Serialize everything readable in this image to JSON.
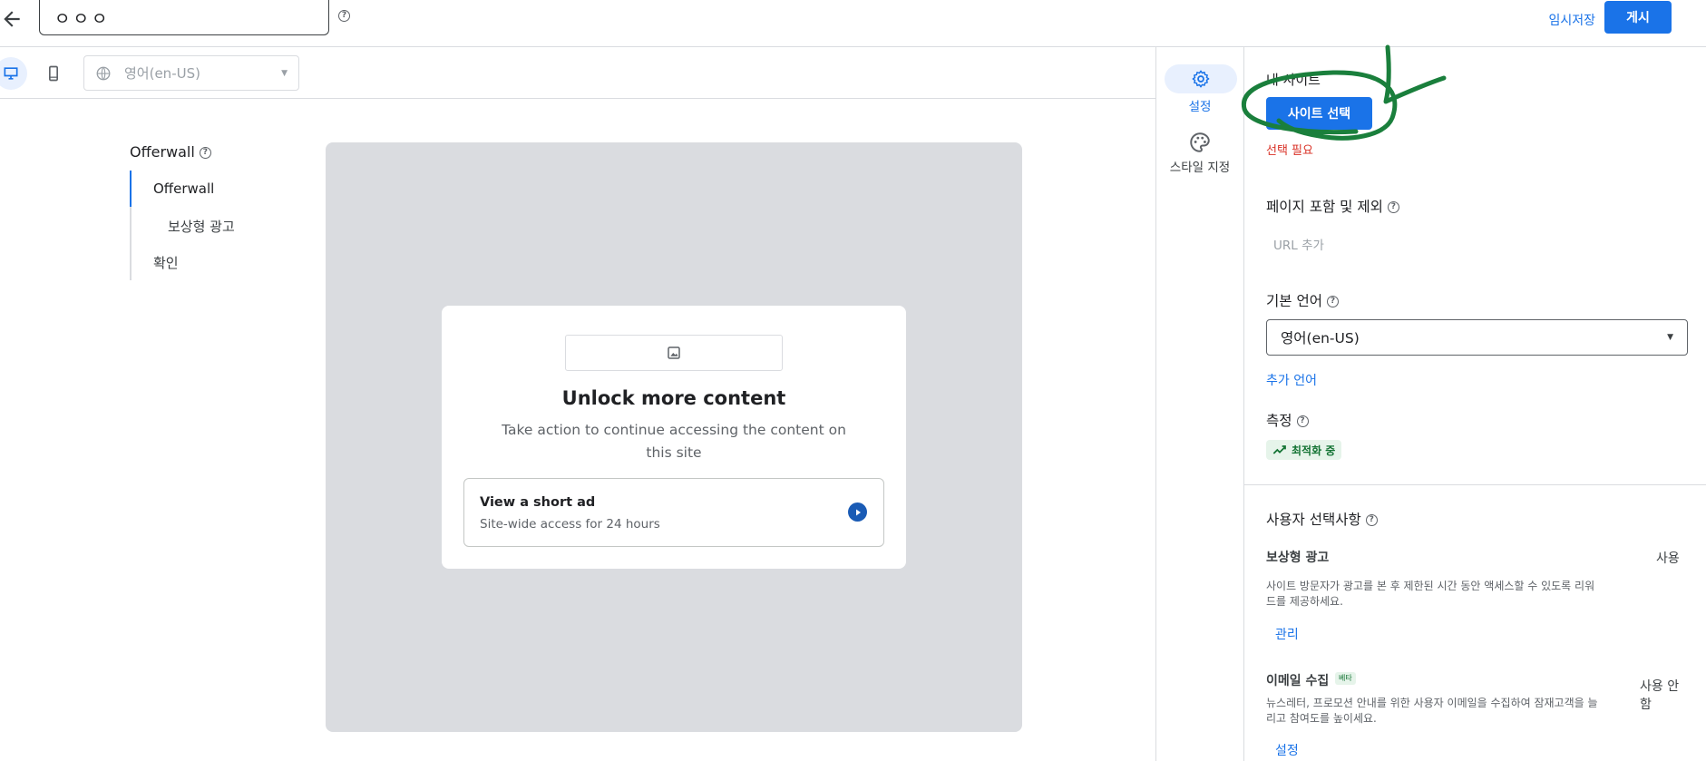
{
  "header": {
    "name_value": "ㅇㅇㅇ",
    "draft_label": "임시저장",
    "publish_label": "게시"
  },
  "toolbar": {
    "preview_language": "영어(en-US)"
  },
  "nav": {
    "title": "Offerwall",
    "items": [
      {
        "label": "Offerwall"
      },
      {
        "label": "보상형 광고"
      },
      {
        "label": "확인"
      }
    ]
  },
  "preview": {
    "title": "Unlock more content",
    "description": "Take action to continue accessing the content on this site",
    "option_title": "View a short ad",
    "option_subtitle": "Site-wide access for 24 hours"
  },
  "rail": {
    "settings_label": "설정",
    "style_label": "스타일 지정"
  },
  "panel": {
    "my_sites_label": "내 사이트",
    "select_site_button": "사이트 선택",
    "required_text": "선택 필요",
    "page_include_title": "페이지 포함 및 제외",
    "url_add_label": "URL 추가",
    "default_language_title": "기본 언어",
    "default_language_value": "영어(en-US)",
    "add_language_link": "추가 언어",
    "measurement_title": "측정",
    "optimizing_badge": "최적화 중",
    "user_choice_title": "사용자 선택사항",
    "rewarded": {
      "title": "보상형 광고",
      "status": "사용",
      "description": "사이트 방문자가 광고를 본 후 제한된 시간 동안 액세스할 수 있도록 리워드를 제공하세요.",
      "manage_link": "관리"
    },
    "email": {
      "title": "이메일 수집",
      "beta_badge": "베타",
      "status": "사용 안함",
      "description": "뉴스레터, 프로모션 안내를 위한 사용자 이메일을 수집하여 잠재고객을 늘리고 참여도를 높이세요.",
      "settings_link": "설정"
    }
  },
  "colors": {
    "accent": "#1a73e8",
    "annotation": "#1a7f3c",
    "preview_bg": "#dadce0",
    "error": "#d93025"
  }
}
